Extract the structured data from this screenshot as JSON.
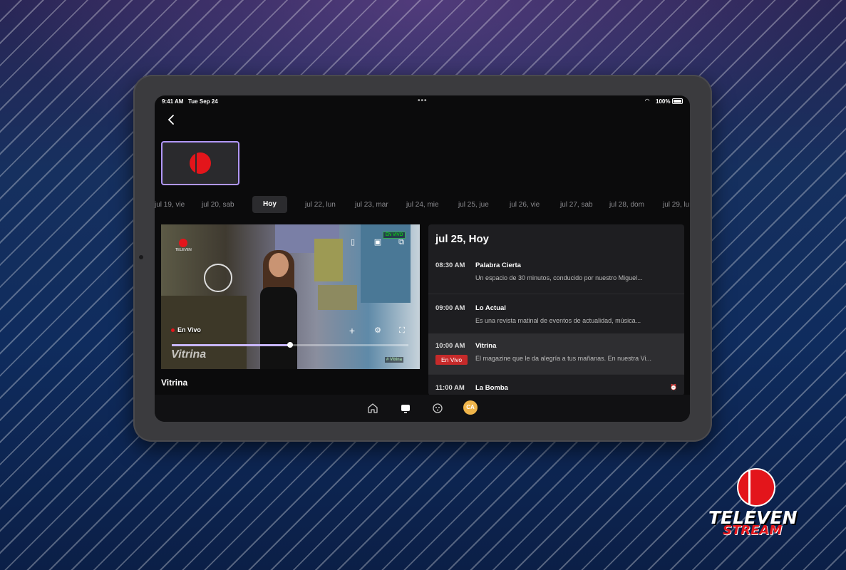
{
  "status": {
    "time": "9:41 AM",
    "date": "Tue Sep 24",
    "battery": "100%"
  },
  "dates": [
    {
      "label": "jul 19, vie",
      "active": false
    },
    {
      "label": "jul 20, sab",
      "active": false
    },
    {
      "label": "Hoy",
      "active": true
    },
    {
      "label": "jul 22, lun",
      "active": false
    },
    {
      "label": "jul 23, mar",
      "active": false
    },
    {
      "label": "jul 24, mie",
      "active": false
    },
    {
      "label": "jul 25, jue",
      "active": false
    },
    {
      "label": "jul 26, vie",
      "active": false
    },
    {
      "label": "jul 27, sab",
      "active": false
    },
    {
      "label": "jul 28, dom",
      "active": false
    },
    {
      "label": "jul 29, lu",
      "active": false
    }
  ],
  "player": {
    "live_badge": "EN VIVO",
    "live_label": "En Vivo",
    "watermark": "Vitrina",
    "tag": "# Vitrina",
    "channel_mini": "TELEVEN",
    "progress": 0.5
  },
  "program_title": "Vitrina",
  "schedule": {
    "header": "jul 25, Hoy",
    "rows": [
      {
        "time": "08:30 AM",
        "name": "Palabra Cierta",
        "desc": "Un espacio de 30 minutos, conducido por nuestro Miguel...",
        "live": false
      },
      {
        "time": "09:00 AM",
        "name": "Lo Actual",
        "desc": "Es una revista matinal de eventos de actualidad, música...",
        "live": false
      },
      {
        "time": "10:00 AM",
        "name": "Vitrina",
        "desc": "El magazine que le da alegría a tus mañanas. En nuestra Vi...",
        "live": true,
        "badge": "En Vivo"
      },
      {
        "time": "11:00 AM",
        "name": "La Bomba",
        "desc": "",
        "live": false
      }
    ]
  },
  "nav": {
    "avatar": "CA"
  },
  "brand": {
    "name": "TELEVEN",
    "sub": "STREAM"
  },
  "colors": {
    "accent": "#b197fc",
    "live_red": "#c62a2a",
    "brand_red": "#e3151b"
  }
}
